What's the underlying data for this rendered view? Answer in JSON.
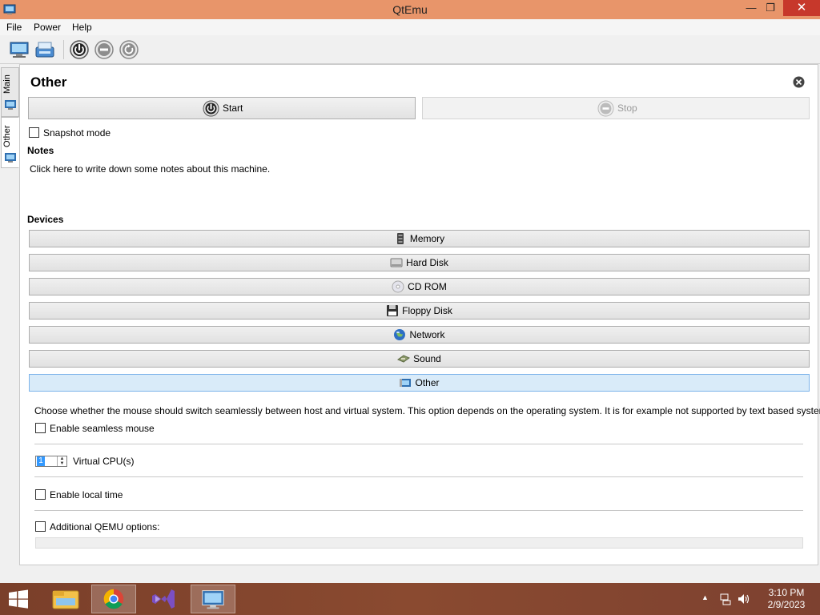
{
  "window": {
    "title": "QtEmu"
  },
  "menu": {
    "items": [
      "File",
      "Power",
      "Help"
    ]
  },
  "toolbar": {
    "buttons": [
      {
        "icon": "new-machine-icon"
      },
      {
        "icon": "open-machine-icon"
      },
      {
        "icon": "power-on-icon"
      },
      {
        "icon": "power-off-icon"
      },
      {
        "icon": "restart-icon"
      }
    ]
  },
  "side_tabs": [
    {
      "label": "Main",
      "active": false
    },
    {
      "label": "Other",
      "active": true
    }
  ],
  "panel": {
    "title": "Other",
    "start_label": "Start",
    "stop_label": "Stop",
    "snapshot_label": "Snapshot mode",
    "notes_title": "Notes",
    "notes_placeholder": "Click here to write down some notes about this machine.",
    "devices_title": "Devices",
    "devices": [
      {
        "label": "Memory",
        "icon": "memory-icon",
        "active": false
      },
      {
        "label": "Hard Disk",
        "icon": "hard-disk-icon",
        "active": false
      },
      {
        "label": "CD ROM",
        "icon": "cd-rom-icon",
        "active": false
      },
      {
        "label": "Floppy Disk",
        "icon": "floppy-disk-icon",
        "active": false
      },
      {
        "label": "Network",
        "icon": "network-icon",
        "active": false
      },
      {
        "label": "Sound",
        "icon": "sound-icon",
        "active": false
      },
      {
        "label": "Other",
        "icon": "other-icon",
        "active": true
      }
    ],
    "other": {
      "description": "Choose whether the mouse should switch seamlessly between host and virtual system. This option depends on the operating system. It is for example not supported by text based systems.",
      "seamless_label": "Enable seamless mouse",
      "cpu_value": "1",
      "cpu_label": "Virtual CPU(s)",
      "localtime_label": "Enable local time",
      "qemu_options_label": "Additional QEMU options:"
    }
  },
  "taskbar": {
    "apps": [
      "file-explorer-icon",
      "chrome-icon",
      "visual-studio-icon",
      "qtemu-icon"
    ],
    "time": "3:10 PM",
    "date": "2/9/2023"
  },
  "colors": {
    "titlebar": "#e8956a",
    "close": "#c7382b",
    "active_device": "#d9ebf9",
    "taskbar": "#7a3f2a"
  }
}
